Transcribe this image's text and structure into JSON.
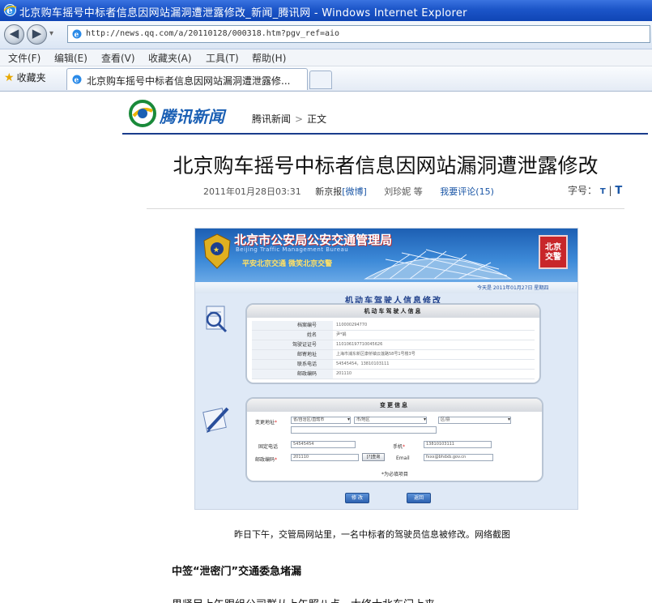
{
  "window": {
    "title": "北京购车摇号中标者信息因网站漏洞遭泄露修改_新闻_腾讯网 - Windows Internet Explorer"
  },
  "navigation": {
    "back_label": "◀",
    "forward_label": "▶",
    "dropdown_label": "▾",
    "url": "http://news.qq.com/a/20110128/000318.htm?pgv_ref=aio"
  },
  "menu": {
    "items": [
      "文件(F)",
      "编辑(E)",
      "查看(V)",
      "收藏夹(A)",
      "工具(T)",
      "帮助(H)"
    ]
  },
  "favorites": {
    "label": "收藏夹"
  },
  "tab": {
    "label": "北京购车摇号中标者信息因网站漏洞遭泄露修..."
  },
  "site": {
    "logo_text": "腾讯新闻",
    "breadcrumb": [
      "腾讯新闻",
      "正文"
    ],
    "breadcrumb_sep": ">"
  },
  "article": {
    "title": "北京购车摇号中标者信息因网站漏洞遭泄露修改",
    "datetime": "2011年01月28日03:31",
    "source_name": "新京报",
    "source_link": "[微博]",
    "author": "刘珍妮 等",
    "comment_label": "我要评论(15)",
    "font_size_label": "字号：",
    "font_small": "T",
    "font_sep": "|",
    "font_large": "T",
    "caption": "昨日下午，交管局网站里，一名中标者的驾驶员信息被修改。网络截图",
    "subhead": "中签“泄密门”交通委急堵漏",
    "next_line": "果紧目上午跟组公司群从上午照八点，大修士北东门上来"
  },
  "screenshot": {
    "banner_title": "北京市公安局公安交通管理局",
    "banner_en": "Beijing Traffic Management Bureau",
    "banner_slogan": "平安北京交通  微笑北京交警",
    "red_logo": "北京\n交警",
    "date_text": "今天是 2011年01月27日 星期四",
    "form_title": "机动车驾驶人信息修改",
    "panel1_title": "机动车驾驶人信息",
    "info_rows": [
      {
        "label": "档案编号",
        "value": "110000294770"
      },
      {
        "label": "姓名",
        "value": "尹*娟"
      },
      {
        "label": "驾驶证证号",
        "value": "110106197710045626"
      },
      {
        "label": "邮寄地址",
        "value": "上海市浦东新区康桥镇云莲路58号1号楼3号"
      },
      {
        "label": "联系电话",
        "value": "54545454，13810103111"
      },
      {
        "label": "邮政编码",
        "value": "201110"
      }
    ],
    "panel2_title": "变更信息",
    "addr_label": "变更地址",
    "sel1": "省/自治区/直辖市",
    "sel2": "市/地区",
    "sel3": "区/县",
    "phone_label": "固定电话",
    "phone_value": "54545454",
    "mobile_label": "手机",
    "mobile_value": "13810103111",
    "zip_label": "邮政编码",
    "zip_value": "201110",
    "query_btn": "[?]查询",
    "email_label": "Email",
    "email_value": "fxxx@bhdxb.gov.cn",
    "note": "*为必填项目",
    "btn_modify": "修 改",
    "btn_back": "返回"
  }
}
